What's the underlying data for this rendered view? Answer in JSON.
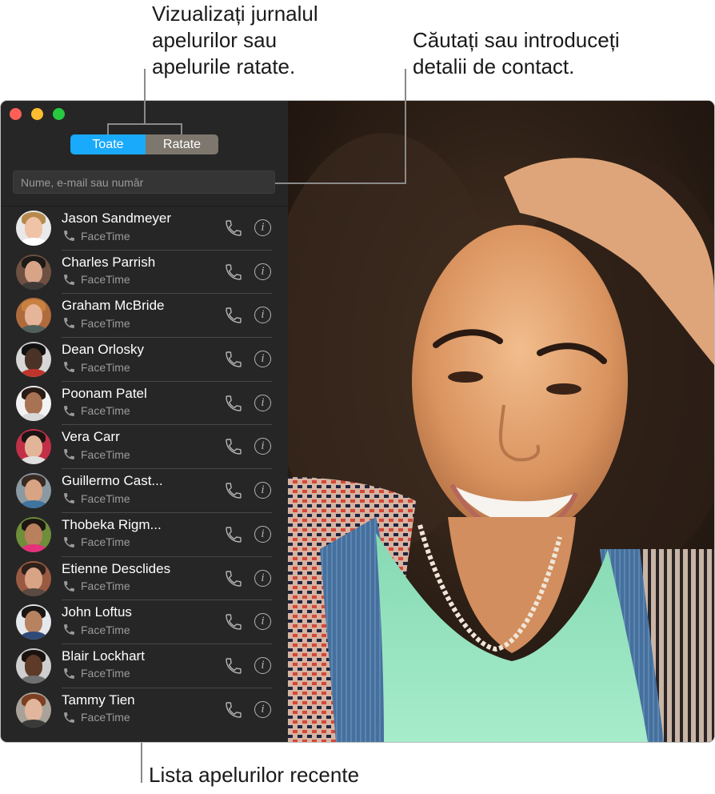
{
  "callouts": {
    "history": "Vizualizați jurnalul\napelurilor sau\napelurile ratate.",
    "search": "Căutați sau introduceți\ndetalii de contact.",
    "recents": "Lista apelurilor recente"
  },
  "window": {
    "segmented_control": {
      "selected": "Toate",
      "options": [
        {
          "label": "Toate",
          "active": true
        },
        {
          "label": "Ratate",
          "active": false
        }
      ]
    },
    "search": {
      "placeholder": "Nume, e-mail sau număr",
      "value": ""
    },
    "recents": [
      {
        "name": "Jason Sandmeyer",
        "type": "FaceTime",
        "avatar": {
          "bg": "#e9e9e9",
          "skin": "#f0c2a6",
          "hair": "#b58a4c",
          "shirt": "#ffffff"
        }
      },
      {
        "name": "Charles Parrish",
        "type": "FaceTime",
        "avatar": {
          "bg": "#6e5142",
          "skin": "#d7a488",
          "hair": "#1d1a18",
          "shirt": "#3f3a38"
        }
      },
      {
        "name": "Graham McBride",
        "type": "FaceTime",
        "avatar": {
          "bg": "#b06b3d",
          "skin": "#e6b499",
          "hair": "#c8823f",
          "shirt": "#52605c"
        }
      },
      {
        "name": "Dean Orlosky",
        "type": "FaceTime",
        "avatar": {
          "bg": "#d7d7d7",
          "skin": "#4b3226",
          "hair": "#111111",
          "shirt": "#c0352b"
        }
      },
      {
        "name": "Poonam Patel",
        "type": "FaceTime",
        "avatar": {
          "bg": "#f2f2f2",
          "skin": "#a87254",
          "hair": "#2a1d17",
          "shirt": "#d8d8d8"
        }
      },
      {
        "name": "Vera Carr",
        "type": "FaceTime",
        "avatar": {
          "bg": "#c23048",
          "skin": "#e3b598",
          "hair": "#1b1514",
          "shirt": "#e0e0e0"
        }
      },
      {
        "name": "Guillermo Cast...",
        "type": "FaceTime",
        "avatar": {
          "bg": "#8a9aa3",
          "skin": "#d9a483",
          "hair": "#3a2b22",
          "shirt": "#3f73a0"
        }
      },
      {
        "name": "Thobeka Rigm...",
        "type": "FaceTime",
        "avatar": {
          "bg": "#6e8e3a",
          "skin": "#b8805d",
          "hair": "#1e1612",
          "shirt": "#e5317b"
        }
      },
      {
        "name": "Etienne Desclides",
        "type": "FaceTime",
        "avatar": {
          "bg": "#9a5a42",
          "skin": "#d9a385",
          "hair": "#2e211b",
          "shirt": "#5a4a42"
        }
      },
      {
        "name": "John Loftus",
        "type": "FaceTime",
        "avatar": {
          "bg": "#e5e8ec",
          "skin": "#b78260",
          "hair": "#1a1613",
          "shirt": "#2e4b78"
        }
      },
      {
        "name": "Blair Lockhart",
        "type": "FaceTime",
        "avatar": {
          "bg": "#cfcfcf",
          "skin": "#5e3a28",
          "hair": "#1a1210",
          "shirt": "#707070"
        }
      },
      {
        "name": "Tammy Tien",
        "type": "FaceTime",
        "avatar": {
          "bg": "#a9a29a",
          "skin": "#e2b69c",
          "hair": "#7d3f22",
          "shirt": "#3a3a3a"
        }
      }
    ]
  },
  "photo": {
    "description": "Video feed of smiling woman with curly hair"
  }
}
